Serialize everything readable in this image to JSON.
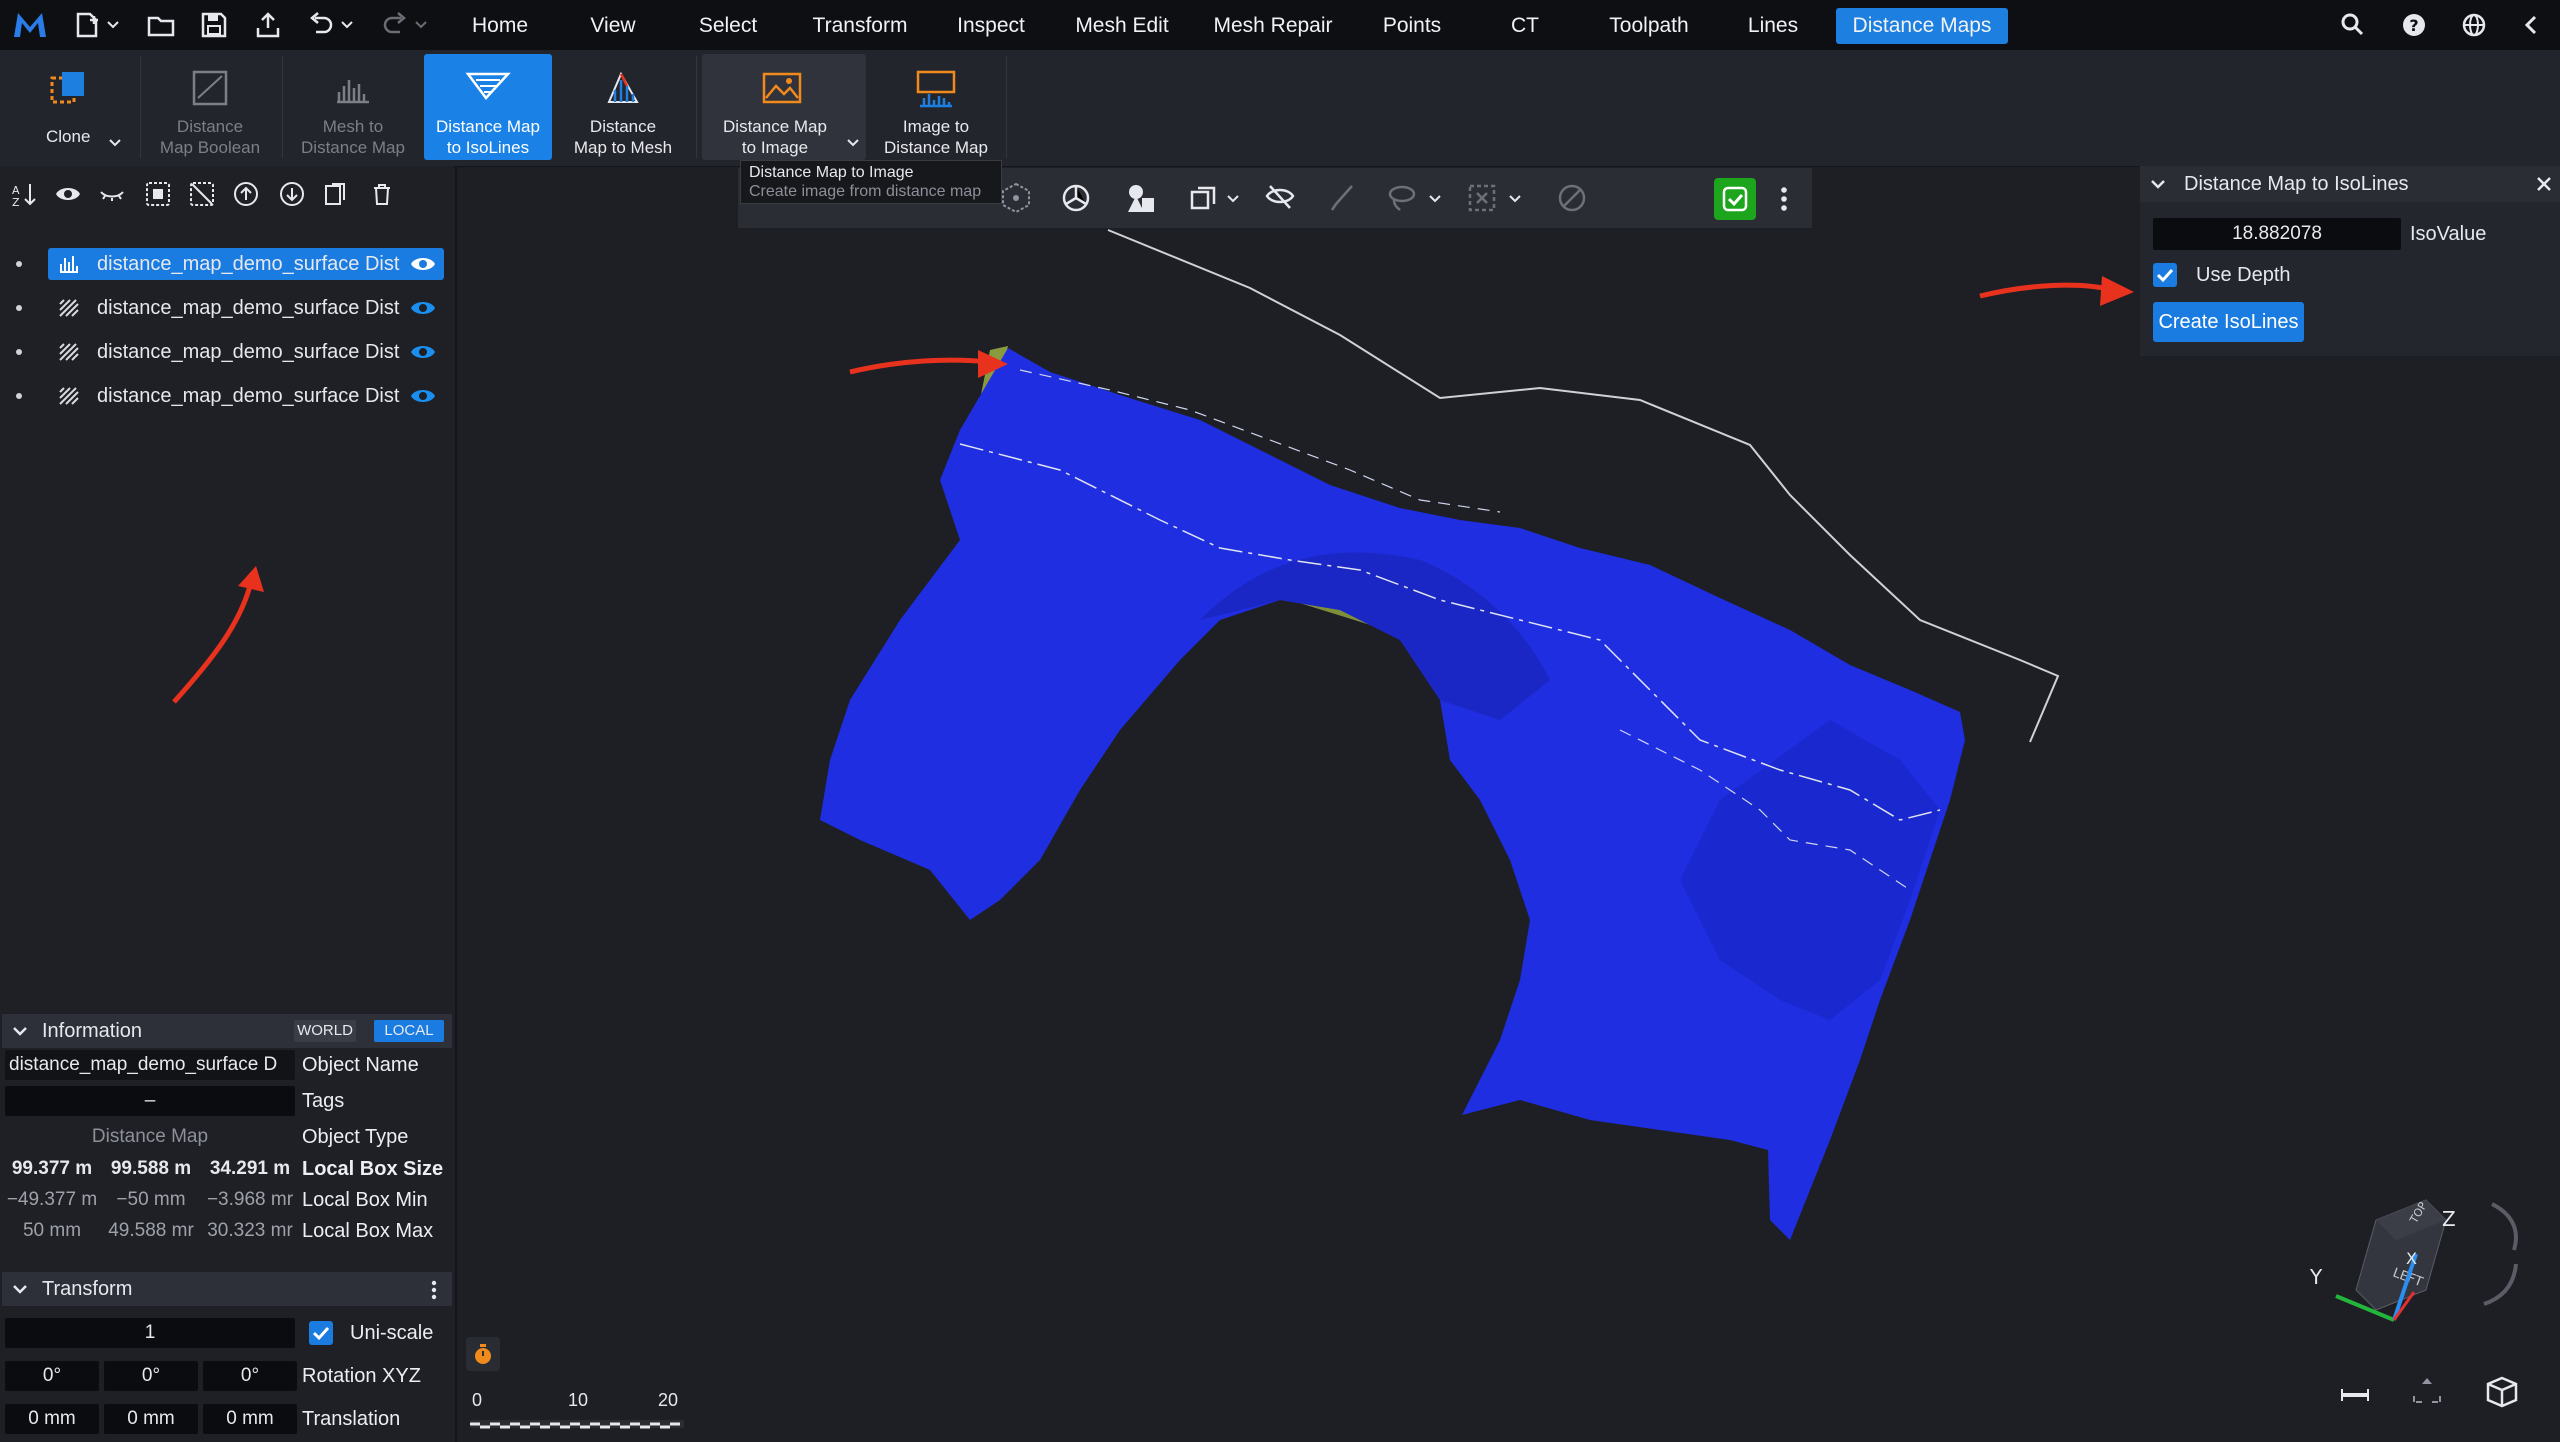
{
  "menubar": {
    "tabs": [
      "Home",
      "View",
      "Select",
      "Transform",
      "Inspect",
      "Mesh Edit",
      "Mesh Repair",
      "Points",
      "CT",
      "Toolpath",
      "Lines",
      "Distance Maps"
    ],
    "active_tab": "Distance Maps",
    "accent": "#1d7fe0"
  },
  "ribbon": {
    "clone": "Clone",
    "distance_map_boolean": [
      "Distance",
      "Map Boolean"
    ],
    "mesh_to_distance_map": [
      "Mesh to",
      "Distance Map"
    ],
    "distance_map_to_isolines": [
      "Distance Map",
      "to IsoLines"
    ],
    "distance_map_to_mesh": [
      "Distance",
      "Map to Mesh"
    ],
    "distance_map_to_image": [
      "Distance Map",
      "to Image"
    ],
    "image_to_distance_map": [
      "Image to",
      "Distance Map"
    ]
  },
  "tooltip": {
    "title": "Distance Map to Image",
    "description": "Create image from distance map"
  },
  "scene_tree": {
    "items": [
      {
        "label": "distance_map_demo_surface Dist",
        "selected": true
      },
      {
        "label": "distance_map_demo_surface Dist",
        "selected": false
      },
      {
        "label": "distance_map_demo_surface Dist",
        "selected": false
      },
      {
        "label": "distance_map_demo_surface Dist",
        "selected": false
      }
    ]
  },
  "information": {
    "header": "Information",
    "world": "WORLD",
    "local": "LOCAL",
    "object_name_value": "distance_map_demo_surface D",
    "object_name_label": "Object Name",
    "tags_value": "–",
    "tags_label": "Tags",
    "object_type_value": "Distance Map",
    "object_type_label": "Object Type",
    "box_size": [
      "99.377 m",
      "99.588 m",
      "34.291 m"
    ],
    "box_size_label": "Local Box Size",
    "box_min": [
      "−49.377 m",
      "−50 mm",
      "−3.968 mr"
    ],
    "box_min_label": "Local Box Min",
    "box_max": [
      "50 mm",
      "49.588 mr",
      "30.323 mr"
    ],
    "box_max_label": "Local Box Max"
  },
  "transform": {
    "header": "Transform",
    "scale": "1",
    "uniscale_label": "Uni-scale",
    "rotation": [
      "0°",
      "0°",
      "0°"
    ],
    "rotation_label": "Rotation XYZ",
    "translation": [
      "0 mm",
      "0 mm",
      "0 mm"
    ],
    "translation_label": "Translation"
  },
  "isolines_panel": {
    "title": "Distance Map to IsoLines",
    "isovalue": "18.882078",
    "isovalue_label": "IsoValue",
    "use_depth_label": "Use Depth",
    "use_depth": true,
    "create_button": "Create IsoLines"
  },
  "scale_bar": {
    "ticks": [
      "0",
      "10",
      "20"
    ]
  },
  "axes": {
    "y": "Y",
    "z": "Z",
    "x": "X",
    "cube_face_left": "LEFT",
    "cube_face_top": "TOP"
  },
  "colors": {
    "mesh": "#1f2ee0",
    "mesh_inner": "#8a9a3e",
    "annotation_arrow": "#e8321e",
    "check_green": "#1ea51e"
  }
}
